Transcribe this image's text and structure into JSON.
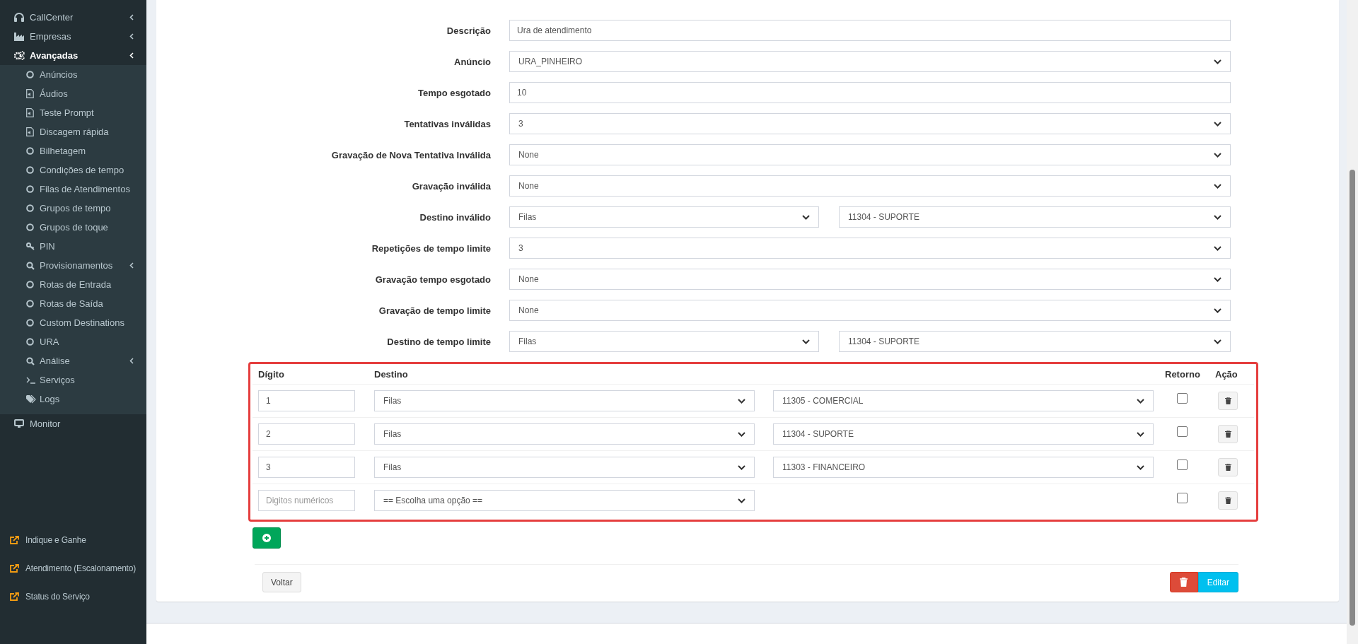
{
  "sidebar": {
    "items": [
      {
        "label": "CallCenter",
        "kind": "headphones",
        "expandable": true,
        "selected": false
      },
      {
        "label": "Empresas",
        "kind": "factory",
        "expandable": true,
        "selected": false
      },
      {
        "label": "Avançadas",
        "kind": "gears",
        "expandable": true,
        "selected": true,
        "children": [
          {
            "label": "Anúncios",
            "kind": "circle",
            "expandable": false
          },
          {
            "label": "Áudios",
            "kind": "audio-file",
            "expandable": false
          },
          {
            "label": "Teste Prompt",
            "kind": "audio-file",
            "expandable": false
          },
          {
            "label": "Discagem rápida",
            "kind": "audio-file",
            "expandable": false
          },
          {
            "label": "Bilhetagem",
            "kind": "circle",
            "expandable": false
          },
          {
            "label": "Condições de tempo",
            "kind": "circle",
            "expandable": false
          },
          {
            "label": "Filas de Atendimentos",
            "kind": "circle",
            "expandable": false
          },
          {
            "label": "Grupos de tempo",
            "kind": "circle",
            "expandable": false
          },
          {
            "label": "Grupos de toque",
            "kind": "circle",
            "expandable": false
          },
          {
            "label": "PIN",
            "kind": "key",
            "expandable": false
          },
          {
            "label": "Provisionamentos",
            "kind": "search",
            "expandable": true
          },
          {
            "label": "Rotas de Entrada",
            "kind": "circle",
            "expandable": false
          },
          {
            "label": "Rotas de Saída",
            "kind": "circle",
            "expandable": false
          },
          {
            "label": "Custom Destinations",
            "kind": "circle",
            "expandable": false
          },
          {
            "label": "URA",
            "kind": "circle",
            "expandable": false
          },
          {
            "label": "Análise",
            "kind": "search",
            "expandable": true
          },
          {
            "label": "Serviços",
            "kind": "terminal",
            "expandable": false
          },
          {
            "label": "Logs",
            "kind": "tags",
            "expandable": false
          }
        ]
      },
      {
        "label": "Monitor",
        "kind": "monitor",
        "expandable": false,
        "selected": false
      }
    ],
    "links": [
      {
        "label": "Indique e Ganhe"
      },
      {
        "label": "Atendimento (Escalonamento)"
      },
      {
        "label": "Status do Serviço"
      }
    ]
  },
  "form": {
    "fields": [
      {
        "label": "Descrição",
        "kind": "input",
        "value": "Ura de atendimento"
      },
      {
        "label": "Anúncio",
        "kind": "select",
        "value": "URA_PINHEIRO"
      },
      {
        "label": "Tempo esgotado",
        "kind": "input",
        "value": "10"
      },
      {
        "label": "Tentativas inválidas",
        "kind": "select",
        "value": "3"
      },
      {
        "label": "Gravação de Nova Tentativa Inválida",
        "kind": "select",
        "value": "None"
      },
      {
        "label": "Gravação inválida",
        "kind": "select",
        "value": "None"
      },
      {
        "label": "Destino inválido",
        "kind": "select_pair",
        "value": "Filas",
        "target": "11304 - SUPORTE"
      },
      {
        "label": "Repetições de tempo limite",
        "kind": "select",
        "value": "3"
      },
      {
        "label": "Gravação tempo esgotado",
        "kind": "select",
        "value": "None"
      },
      {
        "label": "Gravação de tempo limite",
        "kind": "select",
        "value": "None"
      },
      {
        "label": "Destino de tempo limite",
        "kind": "select_pair",
        "value": "Filas",
        "target": "11304 - SUPORTE"
      }
    ]
  },
  "digits": {
    "columns": [
      "Dígito",
      "Destino",
      "Retorno",
      "Ação"
    ],
    "rows": [
      {
        "digit": "1",
        "destination": "Filas",
        "target": "11305 - COMERCIAL",
        "checked": false
      },
      {
        "digit": "2",
        "destination": "Filas",
        "target": "11304 - SUPORTE",
        "checked": false
      },
      {
        "digit": "3",
        "destination": "Filas",
        "target": "11303 - FINANCEIRO",
        "checked": false
      },
      {
        "placeholder": "Digitos numéricos",
        "destination": "== Escolha uma opção ==",
        "checked": false
      }
    ]
  },
  "footer": {
    "back": "Voltar",
    "edit": "Editar"
  }
}
